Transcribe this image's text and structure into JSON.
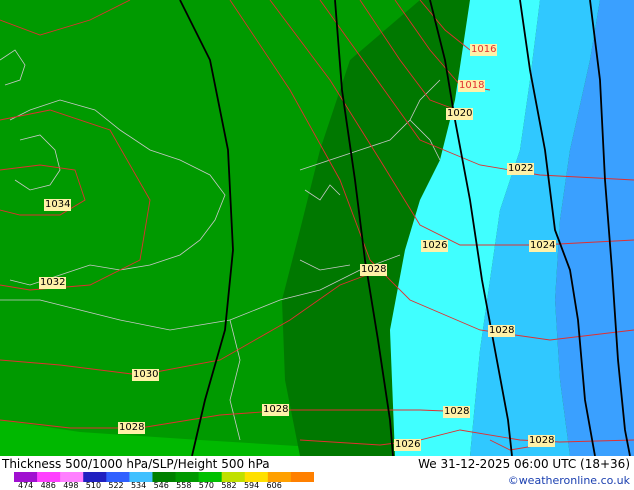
{
  "title": "Thickness 500/1000 hPa/SLP/Height 500 hPa",
  "valid": "We 31-12-2025 06:00 UTC (18+36)",
  "credit": "©weatheronline.co.uk",
  "isobars": [
    {
      "label": "1016"
    },
    {
      "label": "1018"
    },
    {
      "label": "1020"
    },
    {
      "label": "1022"
    },
    {
      "label": "1024"
    },
    {
      "label": "1026"
    },
    {
      "label": "1028"
    },
    {
      "label": "1034"
    },
    {
      "label": "1032"
    },
    {
      "label": "1030"
    },
    {
      "label": "1028"
    },
    {
      "label": "1028"
    },
    {
      "label": "1028"
    },
    {
      "label": "1028"
    },
    {
      "label": "1026"
    },
    {
      "label": "1028"
    }
  ],
  "legend": {
    "ticks": [
      "474",
      "486",
      "498",
      "510",
      "522",
      "534",
      "546",
      "558",
      "570",
      "582",
      "594",
      "606"
    ],
    "colors": [
      "#a010d0",
      "#ff40ff",
      "#ff80ff",
      "#2020c0",
      "#3060ff",
      "#40c0ff",
      "#008000",
      "#009900",
      "#00c000",
      "#c0e000",
      "#ffe000",
      "#ffa000",
      "#ff8000"
    ]
  }
}
